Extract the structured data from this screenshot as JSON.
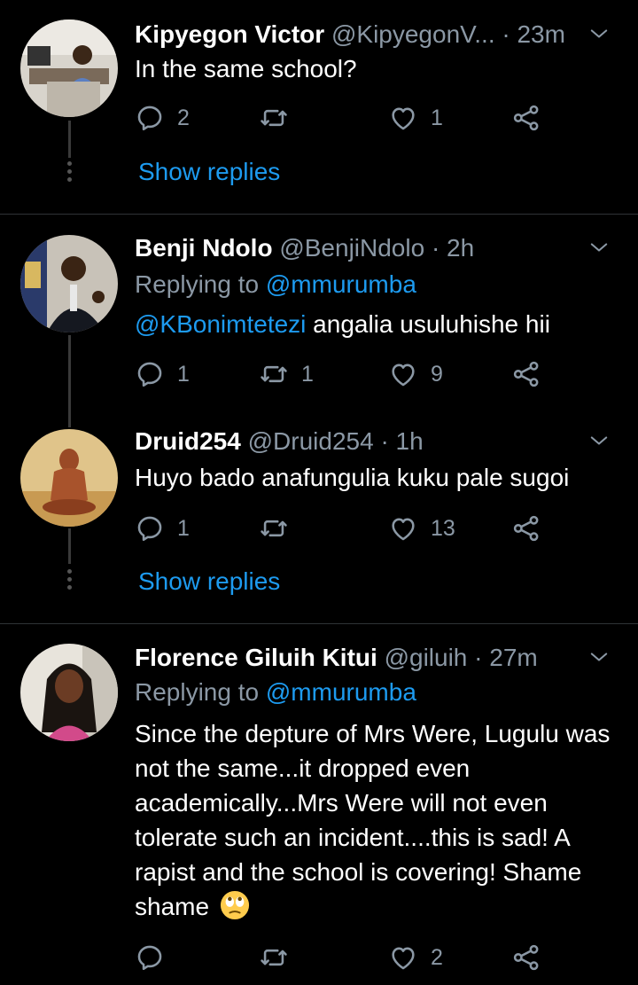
{
  "tweets": [
    {
      "name": "Kipyegon Victor",
      "handle": "@KipyegonV...",
      "time": "· 23m",
      "text": "In the same school?",
      "replies": "2",
      "retweets": "",
      "likes": "1",
      "show_replies": "Show replies"
    },
    {
      "name": "Benji Ndolo",
      "handle": "@BenjiNdolo",
      "time": "· 2h",
      "replying_prefix": "Replying to",
      "replying_to": "@mmurumba",
      "mention": "@KBonimtetezi",
      "text": " angalia usuluhishe hii",
      "replies": "1",
      "retweets": "1",
      "likes": "9"
    },
    {
      "name": "Druid254",
      "handle": "@Druid254",
      "time": "· 1h",
      "text": "Huyo bado anafungulia kuku pale sugoi",
      "replies": "1",
      "retweets": "",
      "likes": "13",
      "show_replies": "Show replies"
    },
    {
      "name": "Florence Giluih Kitui",
      "handle": "@giluih",
      "time": "· 27m",
      "replying_prefix": "Replying to",
      "replying_to": "@mmurumba",
      "text": "Since the depture of Mrs Were, Lugulu was not the same...it dropped even academically...Mrs Were will not even tolerate such an incident....this is sad! A rapist and the school is covering! Shame shame",
      "emoji": "face-with-rolling-eyes",
      "replies": "",
      "retweets": "",
      "likes": "2"
    }
  ],
  "colors": {
    "background": "#000000",
    "text": "#ffffff",
    "secondary": "#8b98a5",
    "link": "#1d9bf0",
    "divider": "#2f3336"
  },
  "icons": {
    "reply": "reply-icon",
    "retweet": "retweet-icon",
    "like": "heart-icon",
    "share": "share-icon",
    "menu": "chevron-down-icon"
  }
}
